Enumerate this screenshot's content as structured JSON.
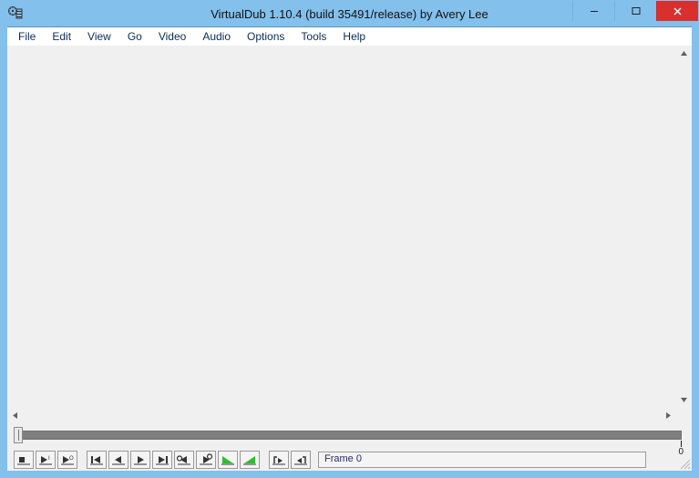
{
  "title": "VirtualDub 1.10.4 (build 35491/release) by Avery Lee",
  "menu": {
    "file": "File",
    "edit": "Edit",
    "view": "View",
    "go": "Go",
    "video": "Video",
    "audio": "Audio",
    "options": "Options",
    "tools": "Tools",
    "help": "Help"
  },
  "seek": {
    "position": 0,
    "end_label": "0"
  },
  "status": {
    "frame_label": "Frame 0"
  },
  "toolbar": {
    "stop": "stop",
    "play_input": "play-input",
    "play_output": "play-output",
    "go_start": "go-start",
    "step_back": "step-back",
    "step_fwd": "step-forward",
    "go_end": "go-end",
    "prev_key": "prev-keyframe",
    "next_key": "next-keyframe",
    "prev_scn": "prev-scene",
    "next_scn": "next-scene",
    "mark_in": "mark-in",
    "mark_out": "mark-out"
  }
}
